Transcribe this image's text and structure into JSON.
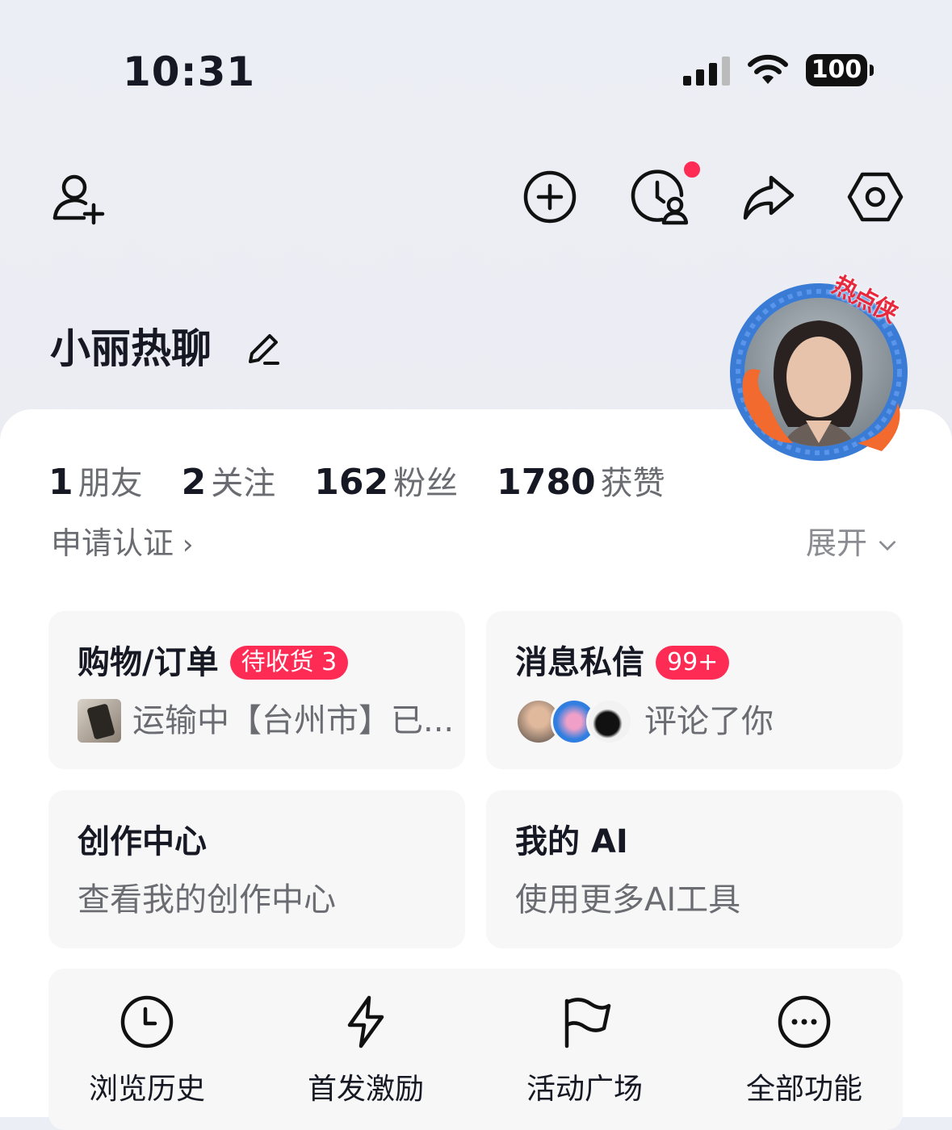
{
  "status_bar": {
    "time": "10:31",
    "battery": "100"
  },
  "profile": {
    "name": "小丽热聊",
    "avatar_badge": "热点侠",
    "stats": [
      {
        "num": "1",
        "label": "朋友"
      },
      {
        "num": "2",
        "label": "关注"
      },
      {
        "num": "162",
        "label": "粉丝"
      },
      {
        "num": "1780",
        "label": "获赞"
      }
    ],
    "cert_link": "申请认证",
    "expand": "展开"
  },
  "cards": {
    "shopping": {
      "title": "购物/订单",
      "badge": "待收货 3",
      "sub": "运输中【台州市】已..."
    },
    "messages": {
      "title": "消息私信",
      "badge": "99+",
      "sub": "评论了你"
    },
    "creator": {
      "title": "创作中心",
      "sub": "查看我的创作中心"
    },
    "ai": {
      "title": "我的 AI",
      "sub": "使用更多AI工具"
    }
  },
  "shortcuts": [
    {
      "label": "浏览历史",
      "icon": "clock-icon"
    },
    {
      "label": "首发激励",
      "icon": "lightning-icon"
    },
    {
      "label": "活动广场",
      "icon": "flag-icon"
    },
    {
      "label": "全部功能",
      "icon": "more-icon"
    }
  ],
  "colors": {
    "accent": "#fe2c55",
    "card_bg": "#f7f7f8",
    "secondary_text": "#6a6c72"
  }
}
